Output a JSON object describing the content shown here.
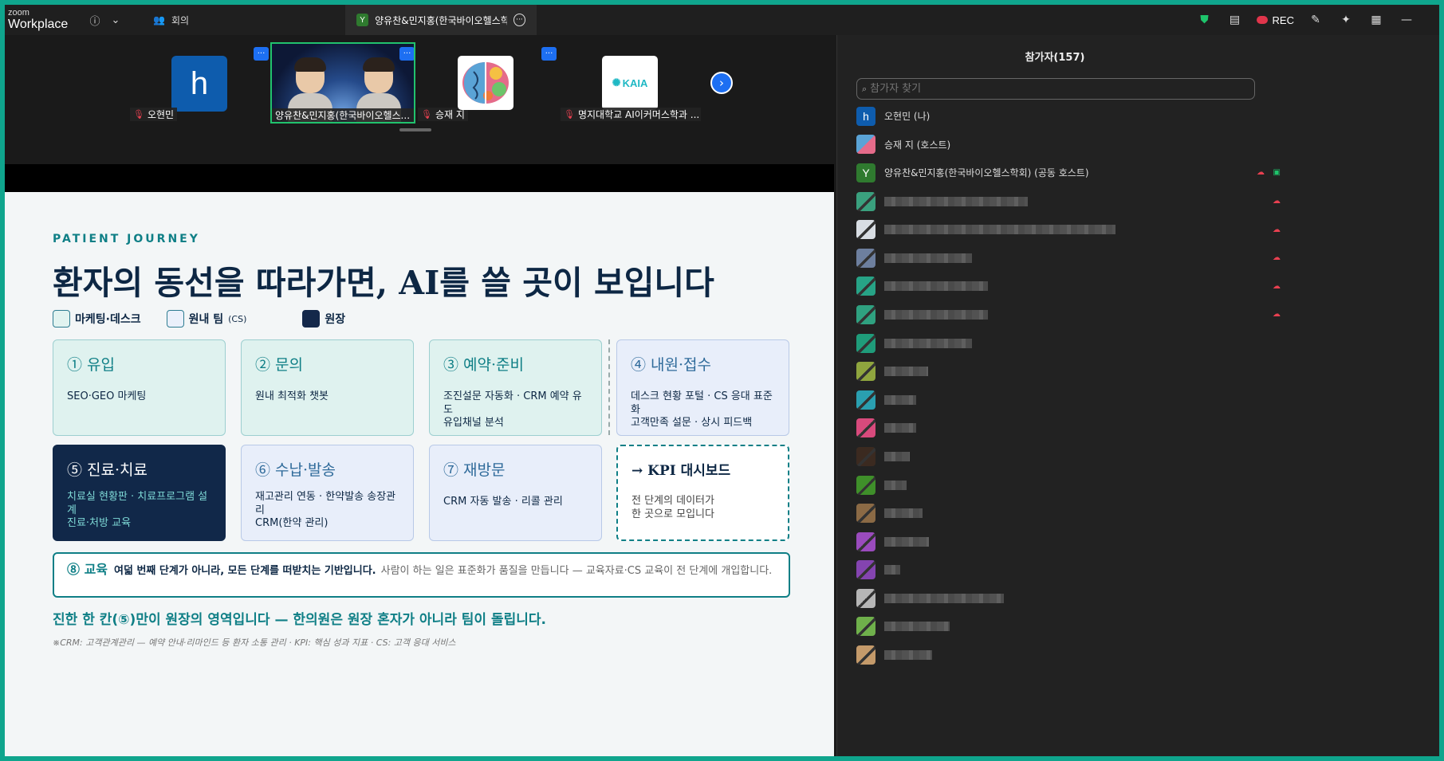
{
  "topbar": {
    "brand_top": "zoom",
    "brand_bottom": "Workplace",
    "meeting_tab": "회의",
    "share_tab_badge": "Y",
    "share_tab_title": "양유찬&민지홍(한국바이오헬스학회)",
    "rec_label": "REC"
  },
  "strip": {
    "tiles": [
      {
        "name": "오현민",
        "avatar_letter": "h"
      },
      {
        "name": "양유찬&민지홍(한국바이오헬스..."
      },
      {
        "name": "승재 지"
      },
      {
        "name": "명지대학교 AI이커머스학과 ..."
      }
    ],
    "kaia_label": "KAIA"
  },
  "slide": {
    "eyebrow": "PATIENT JOURNEY",
    "headline": "환자의 동선을 따라가면, AI를 쓸 곳이 보입니다",
    "legend": {
      "marketing": "마케팅·데스크",
      "team_main": "원내 팀",
      "team_small": "(CS)",
      "director": "원장"
    },
    "cards": [
      {
        "title": "① 유입",
        "desc": "SEO·GEO 마케팅"
      },
      {
        "title": "② 문의",
        "desc": "원내 최적화 챗봇"
      },
      {
        "title": "③ 예약·준비",
        "desc": "조진설문 자동화 · CRM 예약 유도\n유입채널 분석"
      },
      {
        "title": "④ 내원·접수",
        "desc": "데스크 현황 포털 · CS 응대 표준화\n고객만족 설문 · 상시 피드백"
      },
      {
        "title": "⑤ 진료·치료",
        "desc": "치료실 현황판 · 치료프로그램 설계\n진료·처방 교육"
      },
      {
        "title": "⑥ 수납·발송",
        "desc": "재고관리 연동 · 한약발송 송장관리\nCRM(한약 관리)"
      },
      {
        "title": "⑦ 재방문",
        "desc": "CRM 자동 발송 · 리콜 관리"
      },
      {
        "title": "→ KPI 대시보드",
        "desc": "전 단계의 데이터가\n한 곳으로 모입니다"
      }
    ],
    "education": {
      "title": "⑧ 교육",
      "bold": "여덟 번째 단계가 아니라, 모든 단계를 떠받치는 기반입니다.",
      "note": "사람이 하는 일은 표준화가 품질을 만듭니다 — 교육자료·CS 교육이 전 단계에 개입합니다."
    },
    "closing": "진한 한 칸(⑤)만이 원장의 영역입니다 — 한의원은 원장 혼자가 아니라 팀이 돌립니다.",
    "footnote": "※CRM: 고객관계관리 — 예약 안내·리마인드 등 환자 소통 관리 · KPI: 핵심 성과 지표 · CS: 고객 응대 서비스"
  },
  "panel": {
    "title": "참가자(157)",
    "search_placeholder": "참가자 찾기",
    "participants": [
      {
        "name": "오현민 (나)",
        "avatar": "h",
        "color": "#0e5cad"
      },
      {
        "name": "승재 지 (호스트)",
        "avatar": "",
        "color": "#c95ea6"
      },
      {
        "name": "양유찬&민지홍(한국바이오헬스학회) (공동 호스트)",
        "avatar": "Y",
        "color": "#2f7a2f"
      }
    ],
    "blurred_colors": [
      "#3aa07e",
      "#d8dde3",
      "#6d7f9e",
      "#27a386",
      "#2fa180",
      "#1f9c7a",
      "#8fa53e",
      "#2a9fb0",
      "#d84a7c",
      "#3b2a20",
      "#3f8f2a",
      "#8b6a45",
      "#9a4bbd",
      "#8444b0",
      "#b6b6b6",
      "#6fb04b",
      "#c49a6a"
    ]
  }
}
